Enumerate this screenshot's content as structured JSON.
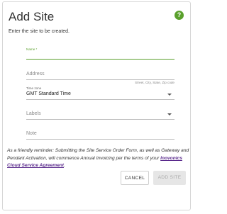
{
  "dialog": {
    "title": "Add Site",
    "subtitle": "Enter the site to be created.",
    "help_icon": "question-circle-icon",
    "help_color": "#5aa02c"
  },
  "fields": {
    "name": {
      "label": "Name *",
      "label_color": "#5aa02c"
    },
    "address": {
      "placeholder": "Address",
      "hint": "Street, City, State, Zip code"
    },
    "timezone": {
      "label": "Time zone",
      "value": "GMT Standard Time"
    },
    "labels": {
      "placeholder": "Labels"
    },
    "note": {
      "placeholder": "Note"
    }
  },
  "reminder": {
    "text": "As a friendly reminder: Submitting the Site Service Order Form, as well as Gateway and Pendant Activation, will commence Annual Invoicing per the terms of your ",
    "link": "Inovonics Cloud Service Agreement",
    "suffix": "."
  },
  "buttons": {
    "cancel": "CANCEL",
    "add": "ADD SITE"
  }
}
